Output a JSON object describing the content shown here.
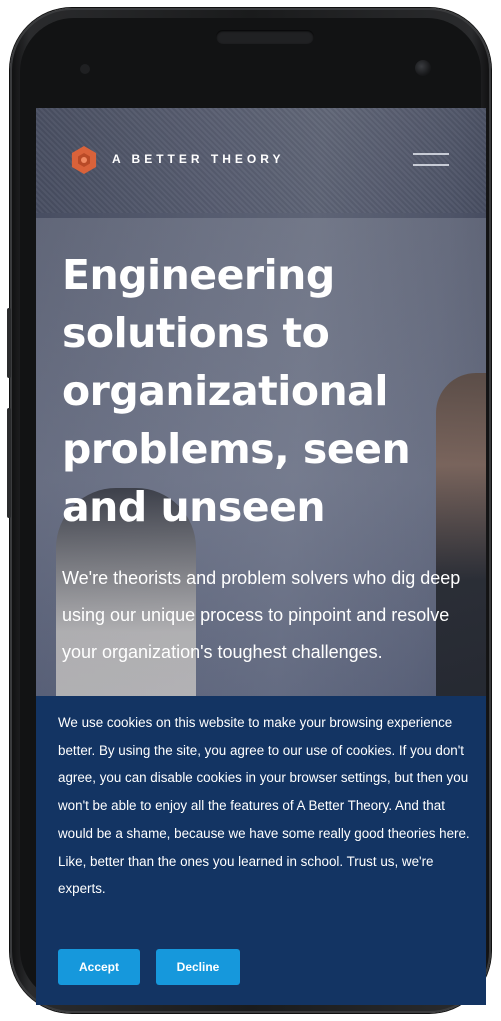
{
  "brand": {
    "name": "A BETTER THEORY",
    "logo_icon": "hexagon-logo-icon",
    "accent_color": "#d9623a"
  },
  "nav": {
    "menu_icon": "hamburger-menu-icon"
  },
  "hero": {
    "headline": "Engineering solutions to organizational problems, seen and unseen",
    "subtext": "We're theorists and problem solvers who dig deep using our unique process to pinpoint and resolve your organization's toughest challenges."
  },
  "cookie_banner": {
    "message": "We use cookies on this website to make your browsing experience better. By using the site, you agree to our use of cookies. If you don't agree, you can disable cookies in your browser settings, but then you won't be able to enjoy all the features of A Better Theory. And that would be a shame, because we have some really good theories here. Like, better than the ones you learned in school. Trust us, we're experts.",
    "accept_label": "Accept",
    "decline_label": "Decline",
    "background_color": "#133463",
    "button_color": "#1698dc"
  }
}
